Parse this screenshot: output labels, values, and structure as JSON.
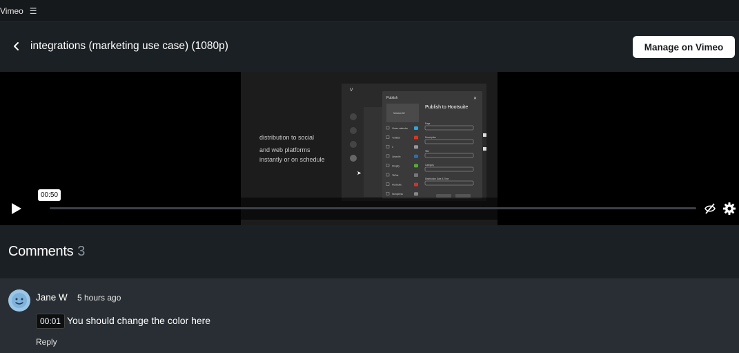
{
  "topbar": {
    "app_name": "Vimeo",
    "menu_icon": "☰"
  },
  "header": {
    "title": "integrations (marketing use case) (1080p)",
    "manage_button": "Manage on Vimeo"
  },
  "player": {
    "video_text_lines": [
      "distribution to social",
      "and web platforms",
      "instantly or on schedule"
    ],
    "modal": {
      "label": "Publish",
      "heading": "Publish to Hootsuite",
      "thumb_label": "Version 02",
      "platforms": [
        "Vimeo calendar",
        "Youtube",
        "X",
        "LinkedIn",
        "Shopify",
        "TikTok",
        "Hootsuite",
        "Wordpress"
      ],
      "fields": [
        "Page",
        "Description",
        "Title",
        "Category",
        "Distribution Date & Time"
      ]
    },
    "hover_time": "00:50",
    "progress_fraction": 0.0
  },
  "comments": {
    "heading": "Comments",
    "count": "3",
    "items": [
      {
        "author": "Jane W",
        "time_ago": "5 hours ago",
        "timestamp": "00:01",
        "text": "You should change the color here",
        "reply_label": "Reply"
      }
    ]
  },
  "colors": {
    "background": "#1a1f24",
    "comment_background": "#282e33",
    "accent": "#ffffff",
    "avatar": "#9bc6e6"
  }
}
